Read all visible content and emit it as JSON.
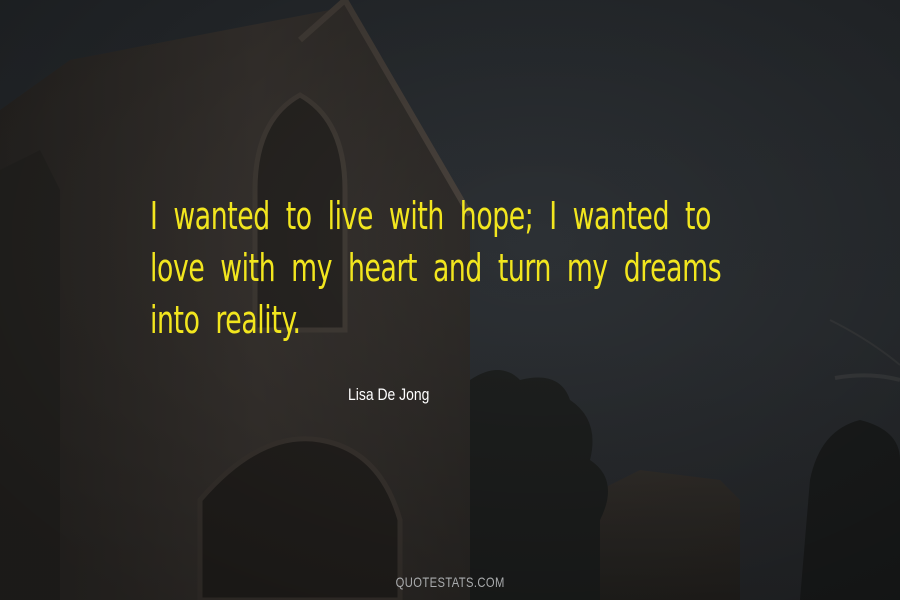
{
  "quote": {
    "lines": [
      "I wanted to live with hope; I wanted to",
      "love with my heart and turn my dreams",
      "into reality."
    ],
    "color": "#f2e61e"
  },
  "author": "Lisa De Jong",
  "watermark": "QUOTESTATS.COM",
  "background": {
    "description_icon": "church-silhouette-dusk",
    "sky_color": "#2d3135",
    "building_color": "#3a3632"
  }
}
